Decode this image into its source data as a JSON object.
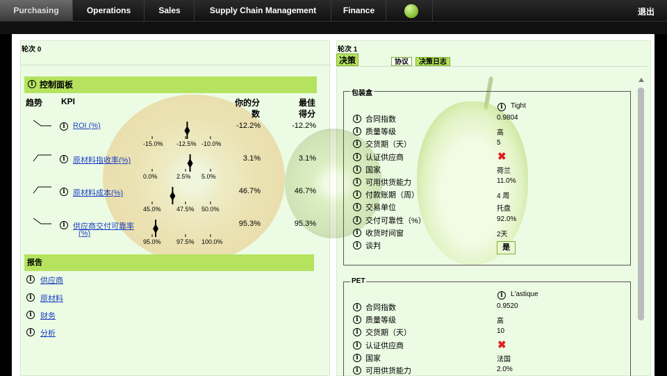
{
  "nav": {
    "tabs": [
      "Purchasing",
      "Operations",
      "Sales",
      "Supply Chain Management",
      "Finance"
    ],
    "logout": "退出"
  },
  "left": {
    "round_title": "轮次 0",
    "dashboard_title": "控制面板",
    "col_trend": "趋势",
    "col_kpi": "KPI",
    "col_score_1": "你的分",
    "col_score_2": "数",
    "col_best_1": "最佳",
    "col_best_2": "得分",
    "kpis": [
      {
        "label_1": "ROI (%)",
        "label_2": "",
        "score": "-12.2%",
        "best": "-12.2%",
        "ticks": [
          "-15.0%",
          "-12.5%",
          "-10.0%"
        ],
        "marker_fraction": 0.6
      },
      {
        "label_1": "原材料指收率(%)",
        "label_2": "",
        "score": "3.1%",
        "best": "3.1%",
        "ticks": [
          "0.0%",
          "2.5%",
          "5.0%"
        ],
        "marker_fraction": 0.65
      },
      {
        "label_1": "原材料成本(%)",
        "label_2": "",
        "score": "46.7%",
        "best": "46.7%",
        "ticks": [
          "45.0%",
          "47.5%",
          "50.0%"
        ],
        "marker_fraction": 0.35
      },
      {
        "label_1": "供应商交付可靠率",
        "label_2": "(%)",
        "score": "95.3%",
        "best": "95.3%",
        "ticks": [
          "95.0%",
          "97.5%",
          "100.0%"
        ],
        "marker_fraction": 0.06
      }
    ],
    "report_title": "报告",
    "reports": [
      "供应商",
      "原材料",
      "财务",
      "分析"
    ]
  },
  "right": {
    "round_title": "轮次 1",
    "tab_decision": "决策",
    "tab_sub": "协议",
    "tab_log": "决策日志",
    "groups": [
      {
        "legend": "包装盒",
        "supplier": "Tight",
        "rows": [
          {
            "label": "合同指数",
            "value": "0.9804"
          },
          {
            "label": "质量等级",
            "value": "高"
          },
          {
            "label": "交货期（天）",
            "value": "5"
          },
          {
            "label": "认证供应商",
            "value": ""
          },
          {
            "label": "国家",
            "value": "荷兰"
          },
          {
            "label": "可用供货能力",
            "value": "11.0%"
          },
          {
            "label": "付款账期（周）",
            "value": "4 周"
          },
          {
            "label": "交易单位",
            "value": "托盘"
          },
          {
            "label": "交付可靠性（%）",
            "value": "92.0%"
          },
          {
            "label": "收货时间窗",
            "value": "2天"
          },
          {
            "label": "谈判",
            "value": ""
          }
        ],
        "negotiate": "是"
      },
      {
        "legend": "PET",
        "supplier": "L'astique",
        "rows": [
          {
            "label": "合同指数",
            "value": "0.9520"
          },
          {
            "label": "质量等级",
            "value": "高"
          },
          {
            "label": "交货期（天）",
            "value": "10"
          },
          {
            "label": "认证供应商",
            "value": ""
          },
          {
            "label": "国家",
            "value": "法国"
          },
          {
            "label": "可用供货能力",
            "value": "2.0%"
          }
        ]
      }
    ],
    "cross_mark": "✖"
  }
}
